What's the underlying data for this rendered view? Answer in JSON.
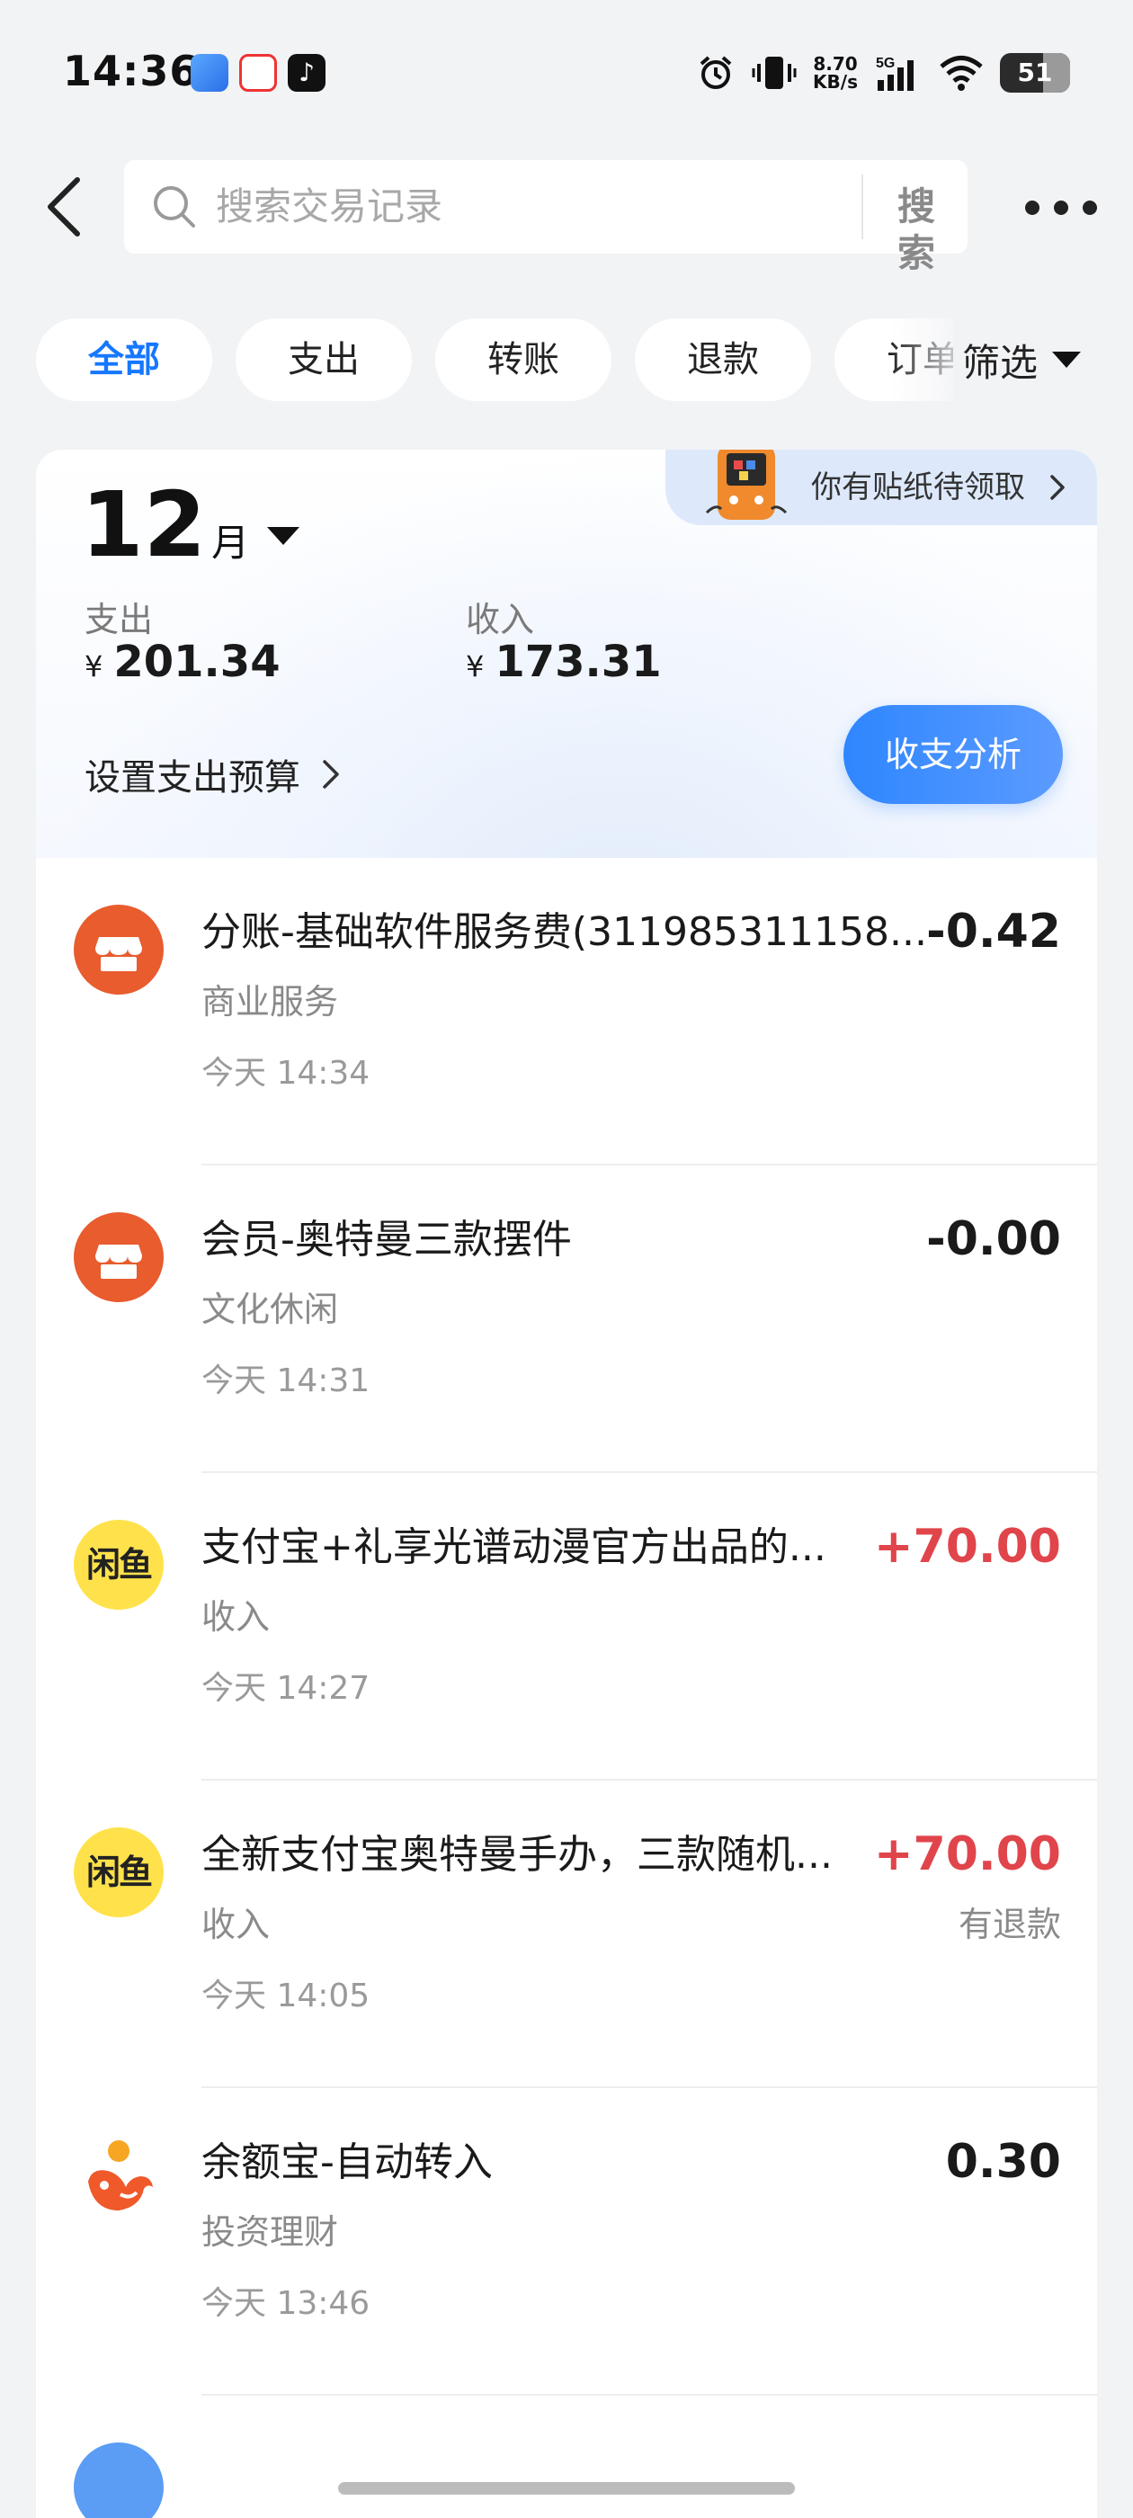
{
  "status_bar": {
    "time": "14:36",
    "net_speed_value": "8.70",
    "net_speed_unit": "KB/s",
    "signal_label": "5G",
    "battery": "51"
  },
  "search": {
    "placeholder": "搜索交易记录",
    "button_label": "搜索"
  },
  "tabs": [
    {
      "label": "全部",
      "active": true
    },
    {
      "label": "支出",
      "active": false
    },
    {
      "label": "转账",
      "active": false
    },
    {
      "label": "退款",
      "active": false
    },
    {
      "label": "订单",
      "active": false
    }
  ],
  "filter_label": "筛选",
  "summary": {
    "month_number": "12",
    "month_unit": "月",
    "expense_label": "支出",
    "expense_value": "201.34",
    "income_label": "收入",
    "income_value": "173.31",
    "currency_symbol": "¥",
    "budget_label": "设置支出预算",
    "analysis_button": "收支分析",
    "sticker_banner": "你有贴纸待领取"
  },
  "transactions": [
    {
      "icon": "shop-icon",
      "title": "分账-基础软件服务费(311985311158...",
      "category": "商业服务",
      "time": "今天 14:34",
      "amount": "-0.42",
      "type": "expense",
      "note": ""
    },
    {
      "icon": "shop-icon",
      "title": "会员-奥特曼三款摆件",
      "category": "文化休闲",
      "time": "今天 14:31",
      "amount": "-0.00",
      "type": "expense",
      "note": ""
    },
    {
      "icon": "xianyu-icon",
      "title": "支付宝+礼享光谱动漫官方出品的...",
      "category": "收入",
      "time": "今天 14:27",
      "amount": "+70.00",
      "type": "income",
      "note": ""
    },
    {
      "icon": "xianyu-icon",
      "title": "全新支付宝奥特曼手办，三款随机...",
      "category": "收入",
      "time": "今天 14:05",
      "amount": "+70.00",
      "type": "income",
      "note": "有退款"
    },
    {
      "icon": "yuebao-icon",
      "title": "余额宝-自动转入",
      "category": "投资理财",
      "time": "今天 13:46",
      "amount": "0.30",
      "type": "neutral",
      "note": ""
    }
  ],
  "xianyu_logo_text": "闲鱼",
  "colors": {
    "accent": "#1677ff",
    "income": "#e0454b",
    "shop_icon": "#e85c2e",
    "xianyu_icon": "#ffe24b",
    "yuebao_icon": "#f0592a"
  }
}
